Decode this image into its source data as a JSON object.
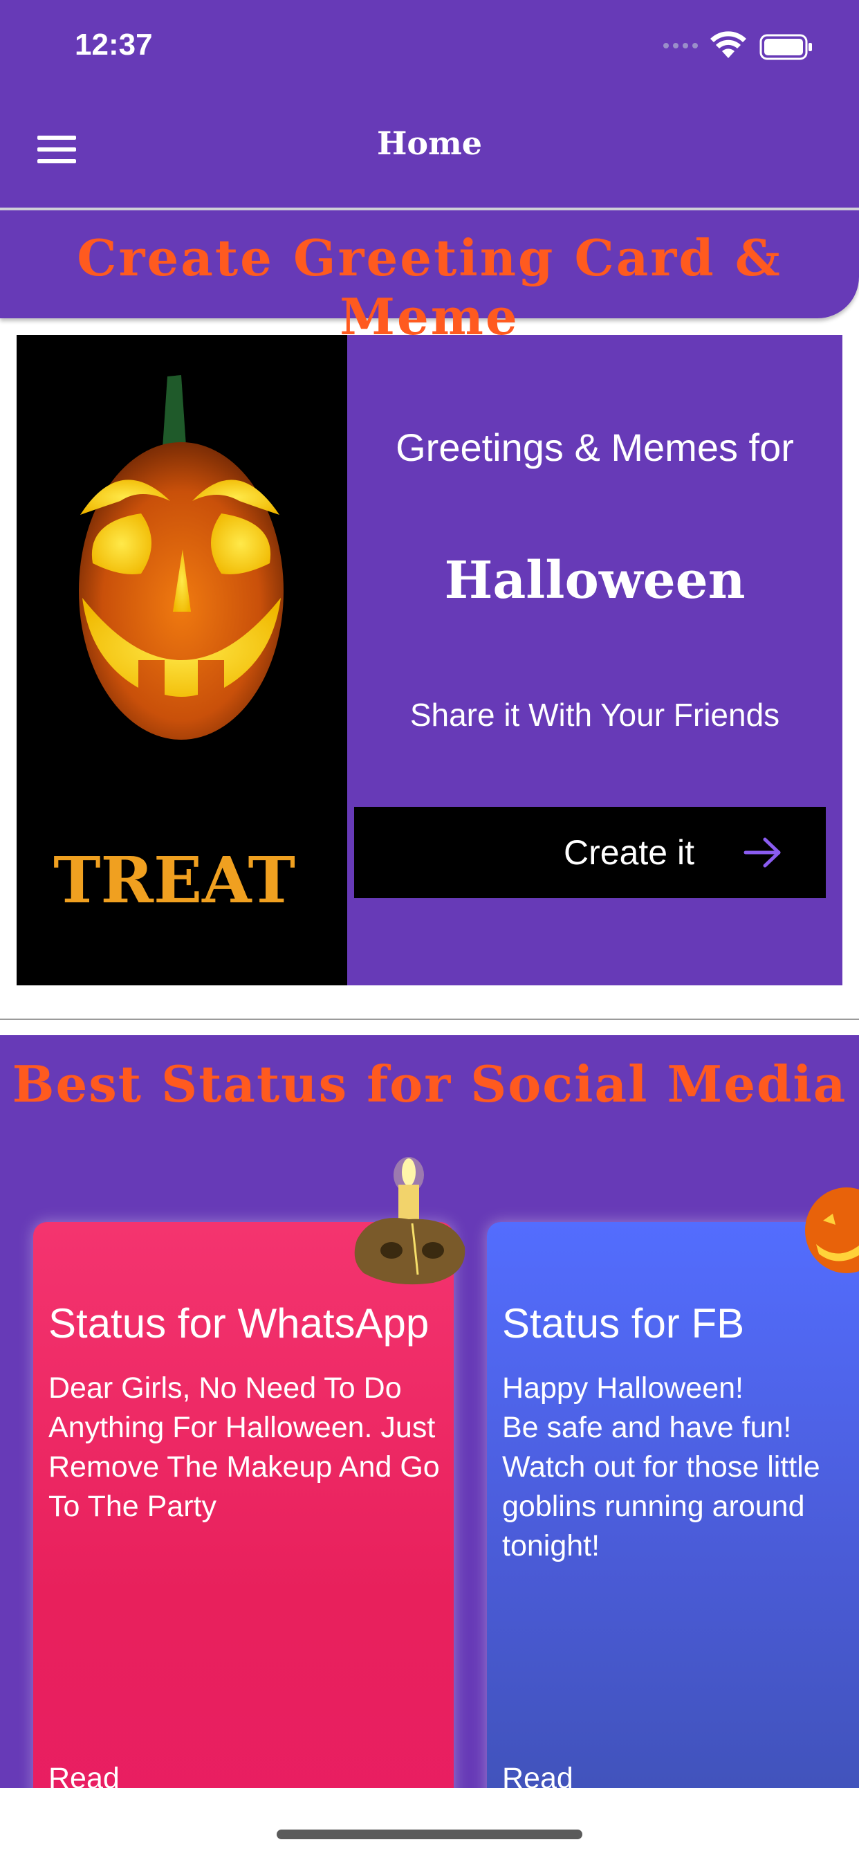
{
  "status_bar": {
    "time": "12:37",
    "signal_icon": "cellular-signal-icon",
    "wifi_icon": "wifi-icon",
    "battery_icon": "battery-icon"
  },
  "nav": {
    "menu_icon": "hamburger-menu-icon",
    "title": "Home"
  },
  "greeting_section": {
    "heading": "Create Greeting Card & Meme",
    "card": {
      "image_text": "TREAT",
      "line1": "Greetings & Memes for",
      "occasion": "Halloween",
      "line3": "Share it With Your Friends",
      "button_label": "Create it",
      "button_icon": "arrow-right-icon"
    }
  },
  "status_section": {
    "heading": "Best Status for Social Media",
    "cards": [
      {
        "title": "Status for WhatsApp",
        "text": "Dear Girls, No Need To Do Anything For Halloween. Just Remove The Makeup And Go To The Party",
        "link": "Read"
      },
      {
        "title": "Status for FB",
        "text": "Happy Halloween!\nBe safe and have fun!\nWatch out for those little goblins running around tonight!",
        "link": "Read"
      }
    ]
  },
  "colors": {
    "primary": "#673ab7",
    "heading_accent": "#ff5a1f",
    "whatsapp_card": "#e91e63",
    "fb_card": "#3f51b5"
  }
}
